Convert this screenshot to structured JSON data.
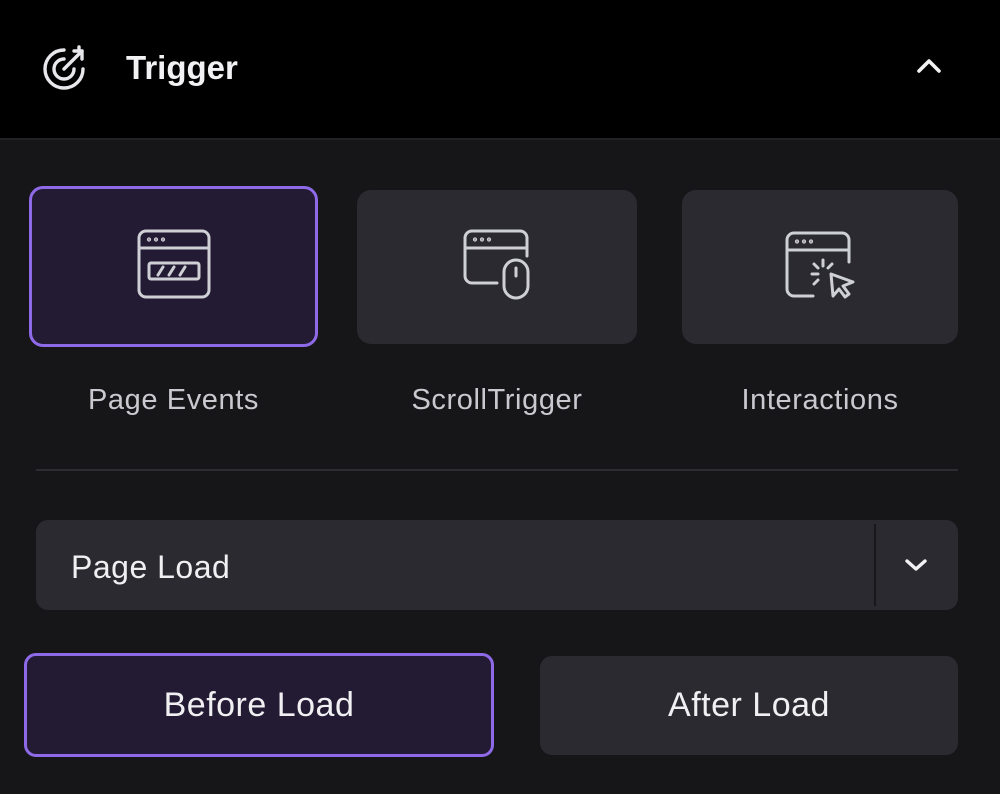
{
  "header": {
    "title": "Trigger",
    "icon": "target-arrow-icon",
    "collapse_icon": "chevron-up-icon"
  },
  "trigger_types": [
    {
      "label": "Page Events",
      "icon": "page-events-icon",
      "selected": true
    },
    {
      "label": "ScrollTrigger",
      "icon": "scroll-trigger-icon",
      "selected": false
    },
    {
      "label": "Interactions",
      "icon": "interactions-icon",
      "selected": false
    }
  ],
  "event_select": {
    "value": "Page Load",
    "icon": "chevron-down-icon"
  },
  "timing": {
    "before_label": "Before Load",
    "after_label": "After Load",
    "selected": "Before Load"
  },
  "colors": {
    "accent": "#8f6ae8",
    "selected_bg": "#231b33",
    "tile_bg": "#2a2a30",
    "panel_bg": "#161618",
    "header_bg": "#000000"
  }
}
